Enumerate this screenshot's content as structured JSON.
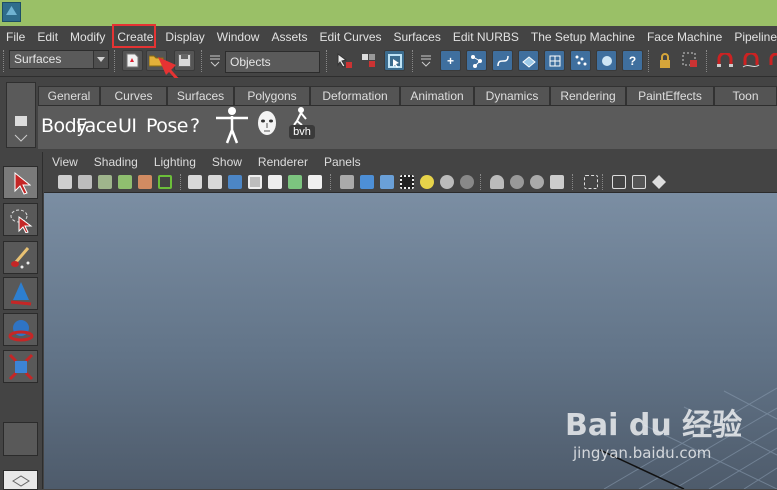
{
  "menubar": {
    "items": [
      "File",
      "Edit",
      "Modify",
      "Create",
      "Display",
      "Window",
      "Assets",
      "Edit Curves",
      "Surfaces",
      "Edit NURBS",
      "The Setup Machine",
      "Face Machine",
      "Pipeline Cache"
    ]
  },
  "toolbar": {
    "menuset_value": "Surfaces",
    "selection_mode_value": "Objects"
  },
  "shelf": {
    "tabs": [
      "General",
      "Curves",
      "Surfaces",
      "Polygons",
      "Deformation",
      "Animation",
      "Dynamics",
      "Rendering",
      "PaintEffects",
      "Toon"
    ],
    "buttons": [
      "Body",
      "Face",
      "UI",
      "Pose",
      "?"
    ],
    "bvh_label": "bvh"
  },
  "panel": {
    "menus": [
      "View",
      "Shading",
      "Lighting",
      "Show",
      "Renderer",
      "Panels"
    ]
  },
  "watermark": {
    "logo": "Bai du 经验",
    "url": "jingyan.baidu.com"
  },
  "colors": {
    "titlebar": "#9ac067",
    "highlight": "#e53333",
    "viewport_top": "#7b8ea3",
    "viewport_bottom": "#4e5b6b"
  }
}
